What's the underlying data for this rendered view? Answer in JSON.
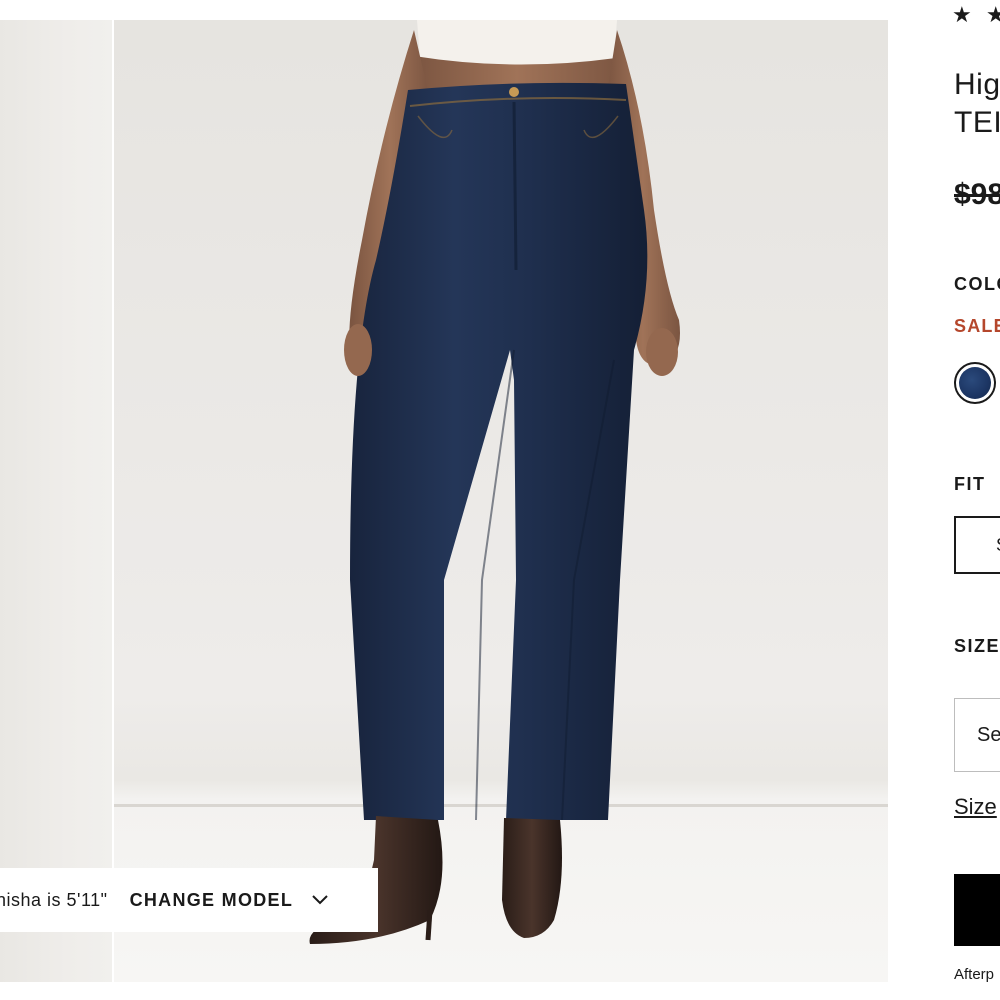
{
  "gallery": {
    "model_height_text": "nisha is 5'11\"",
    "change_model_label": "CHANGE MODEL",
    "jeans_color": "#1d2c48",
    "backdrop_color": "#e9e7e3"
  },
  "product": {
    "rating_stars": "★ ★",
    "title_line1": "Hig",
    "title_line2": "TEI",
    "price_original": "$98",
    "color_label": "COLO",
    "sale_label": "SALE",
    "swatch_color": "#1c3563",
    "fit_label": "FIT",
    "fit_option": "S",
    "size_label": "SIZE",
    "size_placeholder": "Se",
    "size_guide": "Size",
    "afterpay_text": "Afterp"
  },
  "colors": {
    "sale": "#b5472c",
    "text": "#1a1a1a",
    "button": "#000000"
  }
}
